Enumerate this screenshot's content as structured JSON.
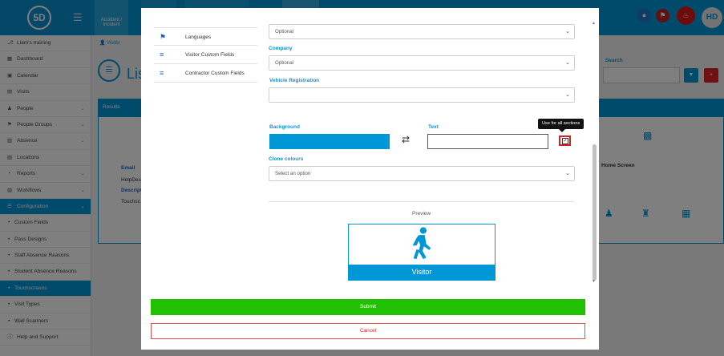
{
  "app": {
    "logo_text": "5D",
    "top_tabs": [
      {
        "label": "Accident / Incident"
      }
    ],
    "avatar_initials": "HD"
  },
  "sidebar": {
    "items": [
      {
        "label": "Liam's training",
        "icon": "branch-icon",
        "chevron": false,
        "active": false,
        "sub": false
      },
      {
        "label": "Dashboard",
        "icon": "dashboard-icon",
        "chevron": false,
        "active": false,
        "sub": false
      },
      {
        "label": "Calendar",
        "icon": "calendar-icon",
        "chevron": false,
        "active": false,
        "sub": false
      },
      {
        "label": "Visits",
        "icon": "visits-icon",
        "chevron": false,
        "active": false,
        "sub": false
      },
      {
        "label": "People",
        "icon": "people-icon",
        "chevron": true,
        "active": false,
        "sub": false
      },
      {
        "label": "People Groups",
        "icon": "groups-icon",
        "chevron": true,
        "active": false,
        "sub": false
      },
      {
        "label": "Absence",
        "icon": "absence-icon",
        "chevron": true,
        "active": false,
        "sub": false
      },
      {
        "label": "Locations",
        "icon": "locations-icon",
        "chevron": false,
        "active": false,
        "sub": false
      },
      {
        "label": "Reports",
        "icon": "reports-icon",
        "chevron": true,
        "active": false,
        "sub": false
      },
      {
        "label": "Workflows",
        "icon": "workflows-icon",
        "chevron": true,
        "active": false,
        "sub": false
      },
      {
        "label": "Configuration",
        "icon": "configuration-icon",
        "chevron": true,
        "active": true,
        "sub": false
      },
      {
        "label": "Custom Fields",
        "icon": "",
        "chevron": false,
        "active": false,
        "sub": true
      },
      {
        "label": "Pass Designs",
        "icon": "",
        "chevron": false,
        "active": false,
        "sub": true
      },
      {
        "label": "Staff Absence Reasons",
        "icon": "",
        "chevron": false,
        "active": false,
        "sub": true
      },
      {
        "label": "Student Absence Reasons",
        "icon": "",
        "chevron": false,
        "active": false,
        "sub": true
      },
      {
        "label": "Touchscreens",
        "icon": "",
        "chevron": false,
        "active": true,
        "sub": true
      },
      {
        "label": "Visit Types",
        "icon": "",
        "chevron": false,
        "active": false,
        "sub": true
      },
      {
        "label": "Wall Scanners",
        "icon": "",
        "chevron": false,
        "active": false,
        "sub": true
      },
      {
        "label": "Help and Support",
        "icon": "help-icon",
        "chevron": false,
        "active": false,
        "sub": false
      }
    ]
  },
  "main": {
    "breadcrumb_visible": "Visitor",
    "page_title_visible": "Lis",
    "results_label": "Results",
    "search_label": "Search",
    "card_visible_texts": [
      "Email",
      "HelpDes",
      "Descript",
      "Touchsc"
    ],
    "home_screen_label": "Home Screen"
  },
  "modal": {
    "nav": [
      {
        "label": "Languages",
        "icon": "flag-icon"
      },
      {
        "label": "Visitor Custom Fields",
        "icon": "checklist-icon"
      },
      {
        "label": "Contractor Custom Fields",
        "icon": "checklist-icon"
      }
    ],
    "top_select_value": "Optional",
    "company_label": "Company",
    "company_value": "Optional",
    "vehicle_label": "Vehicle Registration",
    "vehicle_value": "",
    "background_label": "Background",
    "background_color": "#0097d7",
    "text_label": "Text",
    "text_color": "#ffffff",
    "use_for_all_tooltip": "Use for all sections",
    "use_for_all_checked": true,
    "clone_colours_label": "Clone colours",
    "clone_colours_placeholder": "Select an option",
    "preview_label": "Preview",
    "preview_button_label": "Visitor",
    "submit_label": "Submit",
    "cancel_label": "Cancel"
  },
  "colors": {
    "brand": "#0097d7",
    "submit": "#21c000",
    "cancel": "#e02020",
    "highlight": "#d42020"
  }
}
